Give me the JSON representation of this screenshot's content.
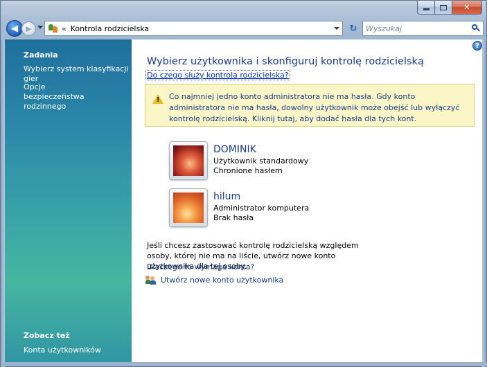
{
  "window": {
    "caption_close": "✕",
    "caption_max": "",
    "caption_min": ""
  },
  "toolbar": {
    "back_glyph": "◀",
    "forward_glyph": "▶",
    "address_chevron": "«",
    "address_text": "Kontrola rodzicielska",
    "refresh_glyph": "↻",
    "search_placeholder": "Wyszukaj"
  },
  "sidebar": {
    "tasks_heading": "Zadania",
    "task_links": [
      "Wybierz system klasyfikacji gier",
      "Opcje bezpieczeństwa rodzinnego"
    ],
    "see_also_heading": "Zobacz też",
    "see_also_links": [
      "Konta użytkowników"
    ]
  },
  "main": {
    "help_glyph": "?",
    "title": "Wybierz użytkownika i skonfiguruj kontrolę rodzicielską",
    "help_link": "Do czego służy kontrola rodzicielska?",
    "warning": {
      "mark": "!",
      "text": "Co najmniej jedno konto administratora nie ma hasła. Gdy konto administratora nie ma hasła, dowolny użytkownik może obejść lub wyłączyć kontrolę rodzicielską. Kliknij tutaj, aby dodać hasła dla tych kont."
    },
    "users": [
      {
        "name": "DOMINIK",
        "type": "Użytkownik standardowy",
        "password": "Chronione hasłem"
      },
      {
        "name": "hilum",
        "type": "Administrator komputera",
        "password": "Brak hasła"
      }
    ],
    "info_text": "Jeśli chcesz zastosować kontrolę rodzicielską względem osoby, której nie ma na liście, utwórz nowe konto użytkownika dla tej osoby.",
    "why_link": "Dlaczego to wymaga konta?",
    "create_link": "Utwórz nowe konto użytkownika"
  }
}
